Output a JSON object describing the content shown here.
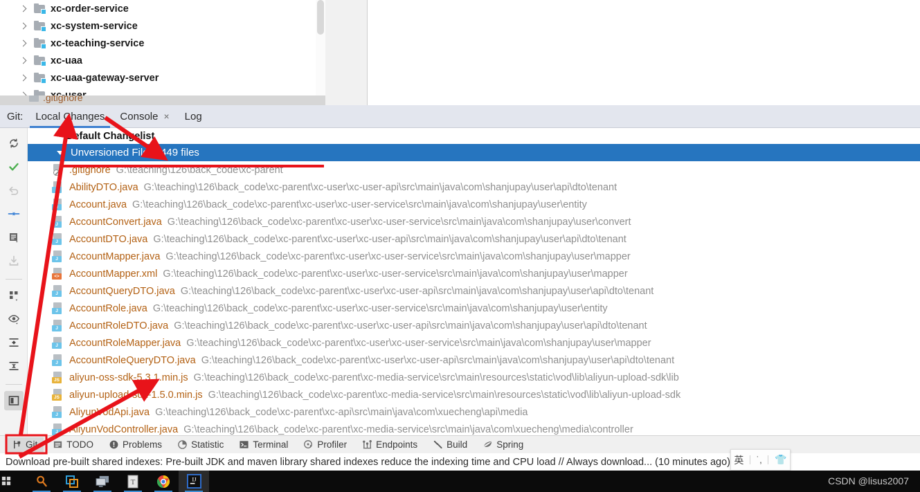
{
  "project_tree": {
    "items": [
      {
        "label": "xc-order-service",
        "icon": "module-folder-icon"
      },
      {
        "label": "xc-system-service",
        "icon": "module-folder-icon"
      },
      {
        "label": "xc-teaching-service",
        "icon": "module-folder-icon"
      },
      {
        "label": "xc-uaa",
        "icon": "module-folder-icon"
      },
      {
        "label": "xc-uaa-gateway-server",
        "icon": "module-folder-icon"
      },
      {
        "label": "xc-user",
        "icon": "module-folder-icon"
      }
    ],
    "clipped_row_label": ".gitignore"
  },
  "git_window": {
    "prefix_label": "Git:",
    "tabs": [
      {
        "label": "Local Changes",
        "active": true,
        "closable": false
      },
      {
        "label": "Console",
        "active": false,
        "closable": true
      },
      {
        "label": "Log",
        "active": false,
        "closable": false
      }
    ],
    "close_glyph": "×",
    "toolbar": [
      {
        "name": "refresh-icon"
      },
      {
        "name": "commit-check-icon"
      },
      {
        "name": "rollback-icon"
      },
      {
        "name": "show-diff-icon"
      },
      {
        "name": "edit-changelist-icon"
      },
      {
        "name": "move-to-changelist-icon"
      },
      {
        "name": "group-by-icon"
      },
      {
        "name": "preview-eye-icon"
      },
      {
        "name": "expand-all-icon"
      },
      {
        "name": "collapse-all-icon"
      },
      {
        "name": "toggle-preview-panel-icon"
      }
    ],
    "changelist": {
      "label": "Default Changelist"
    },
    "unversioned": {
      "label": "Unversioned Files",
      "count_label": "449 files",
      "selected": true,
      "expanded": true
    },
    "files": [
      {
        "name": ".gitignore",
        "path": "G:\\teaching\\126\\back_code\\xc-parent",
        "type": "ignored"
      },
      {
        "name": "AbilityDTO.java",
        "path": "G:\\teaching\\126\\back_code\\xc-parent\\xc-user\\xc-user-api\\src\\main\\java\\com\\shanjupay\\user\\api\\dto\\tenant",
        "type": "java"
      },
      {
        "name": "Account.java",
        "path": "G:\\teaching\\126\\back_code\\xc-parent\\xc-user\\xc-user-service\\src\\main\\java\\com\\shanjupay\\user\\entity",
        "type": "java"
      },
      {
        "name": "AccountConvert.java",
        "path": "G:\\teaching\\126\\back_code\\xc-parent\\xc-user\\xc-user-service\\src\\main\\java\\com\\shanjupay\\user\\convert",
        "type": "java"
      },
      {
        "name": "AccountDTO.java",
        "path": "G:\\teaching\\126\\back_code\\xc-parent\\xc-user\\xc-user-api\\src\\main\\java\\com\\shanjupay\\user\\api\\dto\\tenant",
        "type": "java"
      },
      {
        "name": "AccountMapper.java",
        "path": "G:\\teaching\\126\\back_code\\xc-parent\\xc-user\\xc-user-service\\src\\main\\java\\com\\shanjupay\\user\\mapper",
        "type": "java"
      },
      {
        "name": "AccountMapper.xml",
        "path": "G:\\teaching\\126\\back_code\\xc-parent\\xc-user\\xc-user-service\\src\\main\\java\\com\\shanjupay\\user\\mapper",
        "type": "xml"
      },
      {
        "name": "AccountQueryDTO.java",
        "path": "G:\\teaching\\126\\back_code\\xc-parent\\xc-user\\xc-user-api\\src\\main\\java\\com\\shanjupay\\user\\api\\dto\\tenant",
        "type": "java"
      },
      {
        "name": "AccountRole.java",
        "path": "G:\\teaching\\126\\back_code\\xc-parent\\xc-user\\xc-user-service\\src\\main\\java\\com\\shanjupay\\user\\entity",
        "type": "java"
      },
      {
        "name": "AccountRoleDTO.java",
        "path": "G:\\teaching\\126\\back_code\\xc-parent\\xc-user\\xc-user-api\\src\\main\\java\\com\\shanjupay\\user\\api\\dto\\tenant",
        "type": "java"
      },
      {
        "name": "AccountRoleMapper.java",
        "path": "G:\\teaching\\126\\back_code\\xc-parent\\xc-user\\xc-user-service\\src\\main\\java\\com\\shanjupay\\user\\mapper",
        "type": "java"
      },
      {
        "name": "AccountRoleQueryDTO.java",
        "path": "G:\\teaching\\126\\back_code\\xc-parent\\xc-user\\xc-user-api\\src\\main\\java\\com\\shanjupay\\user\\api\\dto\\tenant",
        "type": "java"
      },
      {
        "name": "aliyun-oss-sdk-5.3.1.min.js",
        "path": "G:\\teaching\\126\\back_code\\xc-parent\\xc-media-service\\src\\main\\resources\\static\\vod\\lib\\aliyun-upload-sdk\\lib",
        "type": "js"
      },
      {
        "name": "aliyun-upload-sdk-1.5.0.min.js",
        "path": "G:\\teaching\\126\\back_code\\xc-parent\\xc-media-service\\src\\main\\resources\\static\\vod\\lib\\aliyun-upload-sdk",
        "type": "js"
      },
      {
        "name": "AliyunVodApi.java",
        "path": "G:\\teaching\\126\\back_code\\xc-parent\\xc-api\\src\\main\\java\\com\\xuecheng\\api\\media",
        "type": "java"
      },
      {
        "name": "AliyunVodController.java",
        "path": "G:\\teaching\\126\\back_code\\xc-parent\\xc-media-service\\src\\main\\java\\com\\xuecheng\\media\\controller",
        "type": "java"
      }
    ]
  },
  "bottom_tool_bar": {
    "items": [
      {
        "label": "Git",
        "icon": "git-branch-icon",
        "active": true
      },
      {
        "label": "TODO",
        "icon": "todo-list-icon",
        "active": false
      },
      {
        "label": "Problems",
        "icon": "problems-warning-icon",
        "active": false
      },
      {
        "label": "Statistic",
        "icon": "statistic-pie-icon",
        "active": false
      },
      {
        "label": "Terminal",
        "icon": "terminal-icon",
        "active": false
      },
      {
        "label": "Profiler",
        "icon": "profiler-icon",
        "active": false
      },
      {
        "label": "Endpoints",
        "icon": "endpoints-icon",
        "active": false
      },
      {
        "label": "Build",
        "icon": "build-hammer-icon",
        "active": false
      },
      {
        "label": "Spring",
        "icon": "spring-leaf-icon",
        "active": false
      }
    ]
  },
  "status_bar": {
    "message": "Download pre-built shared indexes: Pre-built JDK and maven library shared indexes reduce the indexing time and CPU load // Always download... (10 minutes ago)"
  },
  "ime_indicator": {
    "mode_label": "英",
    "punct_glyph": "˙,",
    "tool_glyph": "👕"
  },
  "taskbar": {
    "icons": [
      {
        "name": "search-icon"
      },
      {
        "name": "vmware-icon"
      },
      {
        "name": "remote-desktop-icon"
      },
      {
        "name": "typora-icon"
      },
      {
        "name": "chrome-icon"
      },
      {
        "name": "intellij-idea-icon"
      }
    ],
    "watermark": "CSDN @lisus2007"
  },
  "colors": {
    "selection_blue": "#2675bf",
    "tab_bar": "#e3e6ee",
    "file_name": "#b36114",
    "file_path": "#8f8f8f",
    "annotation_red": "#e8131a",
    "accent_tab_underline": "#3c7fd0"
  }
}
